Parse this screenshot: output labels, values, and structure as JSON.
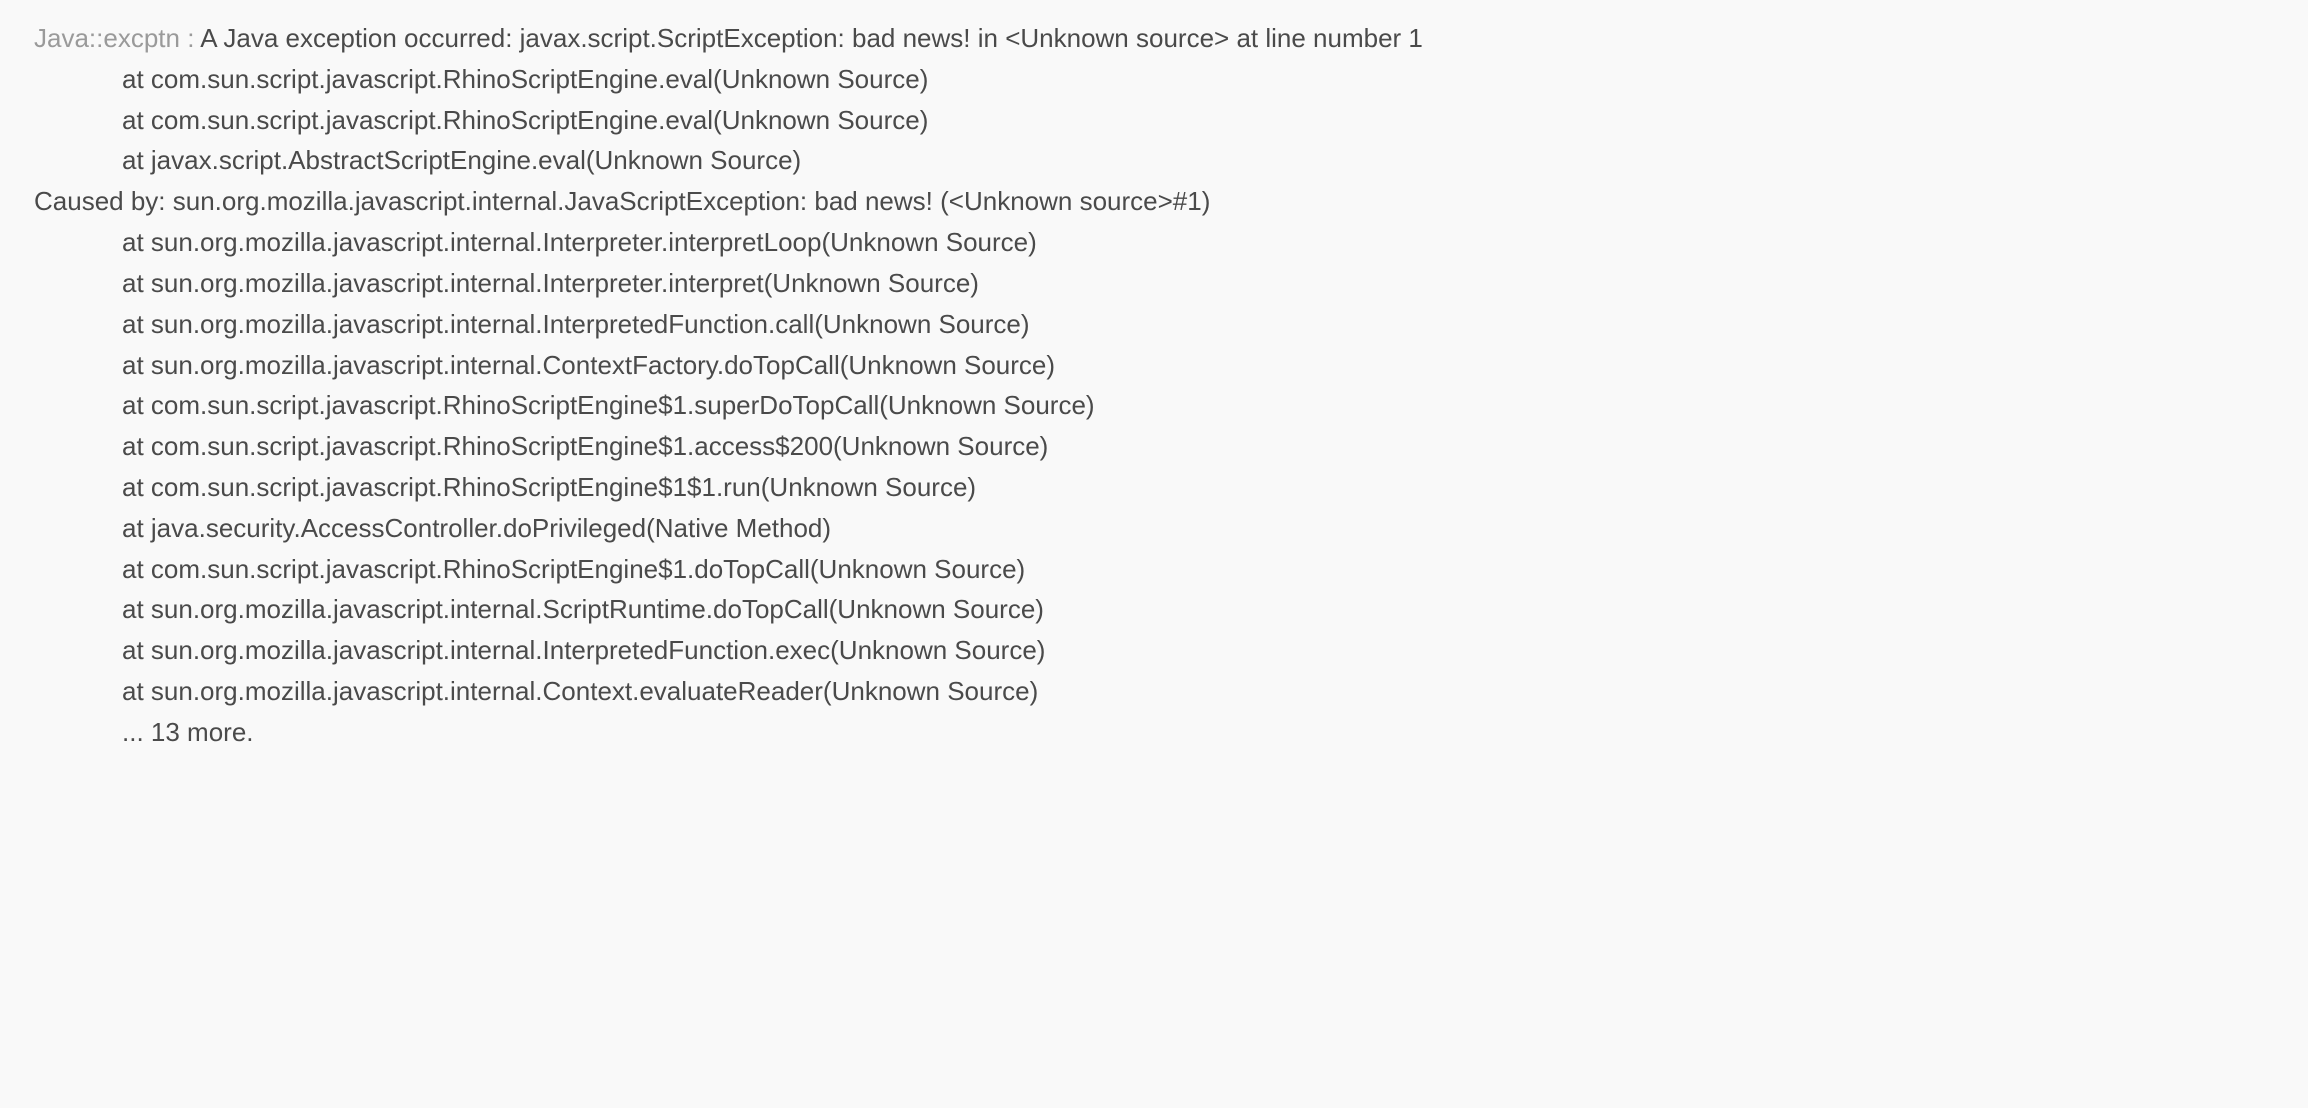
{
  "exception": {
    "class_label": "Java::excptn",
    "separator": " : ",
    "message": "A Java exception occurred: javax.script.ScriptException: bad news! in <Unknown source> at line number 1"
  },
  "stack1": [
    "at com.sun.script.javascript.RhinoScriptEngine.eval(Unknown Source)",
    "at com.sun.script.javascript.RhinoScriptEngine.eval(Unknown Source)",
    "at javax.script.AbstractScriptEngine.eval(Unknown Source)"
  ],
  "caused_by": "Caused by: sun.org.mozilla.javascript.internal.JavaScriptException: bad news! (<Unknown source>#1)",
  "stack2": [
    "at sun.org.mozilla.javascript.internal.Interpreter.interpretLoop(Unknown Source)",
    "at sun.org.mozilla.javascript.internal.Interpreter.interpret(Unknown Source)",
    "at sun.org.mozilla.javascript.internal.InterpretedFunction.call(Unknown Source)",
    "at sun.org.mozilla.javascript.internal.ContextFactory.doTopCall(Unknown Source)",
    "at com.sun.script.javascript.RhinoScriptEngine$1.superDoTopCall(Unknown Source)",
    "at com.sun.script.javascript.RhinoScriptEngine$1.access$200(Unknown Source)",
    "at com.sun.script.javascript.RhinoScriptEngine$1$1.run(Unknown Source)",
    "at java.security.AccessController.doPrivileged(Native Method)",
    "at com.sun.script.javascript.RhinoScriptEngine$1.doTopCall(Unknown Source)",
    "at sun.org.mozilla.javascript.internal.ScriptRuntime.doTopCall(Unknown Source)",
    "at sun.org.mozilla.javascript.internal.InterpretedFunction.exec(Unknown Source)",
    "at sun.org.mozilla.javascript.internal.Context.evaluateReader(Unknown Source)",
    "... 13 more."
  ]
}
